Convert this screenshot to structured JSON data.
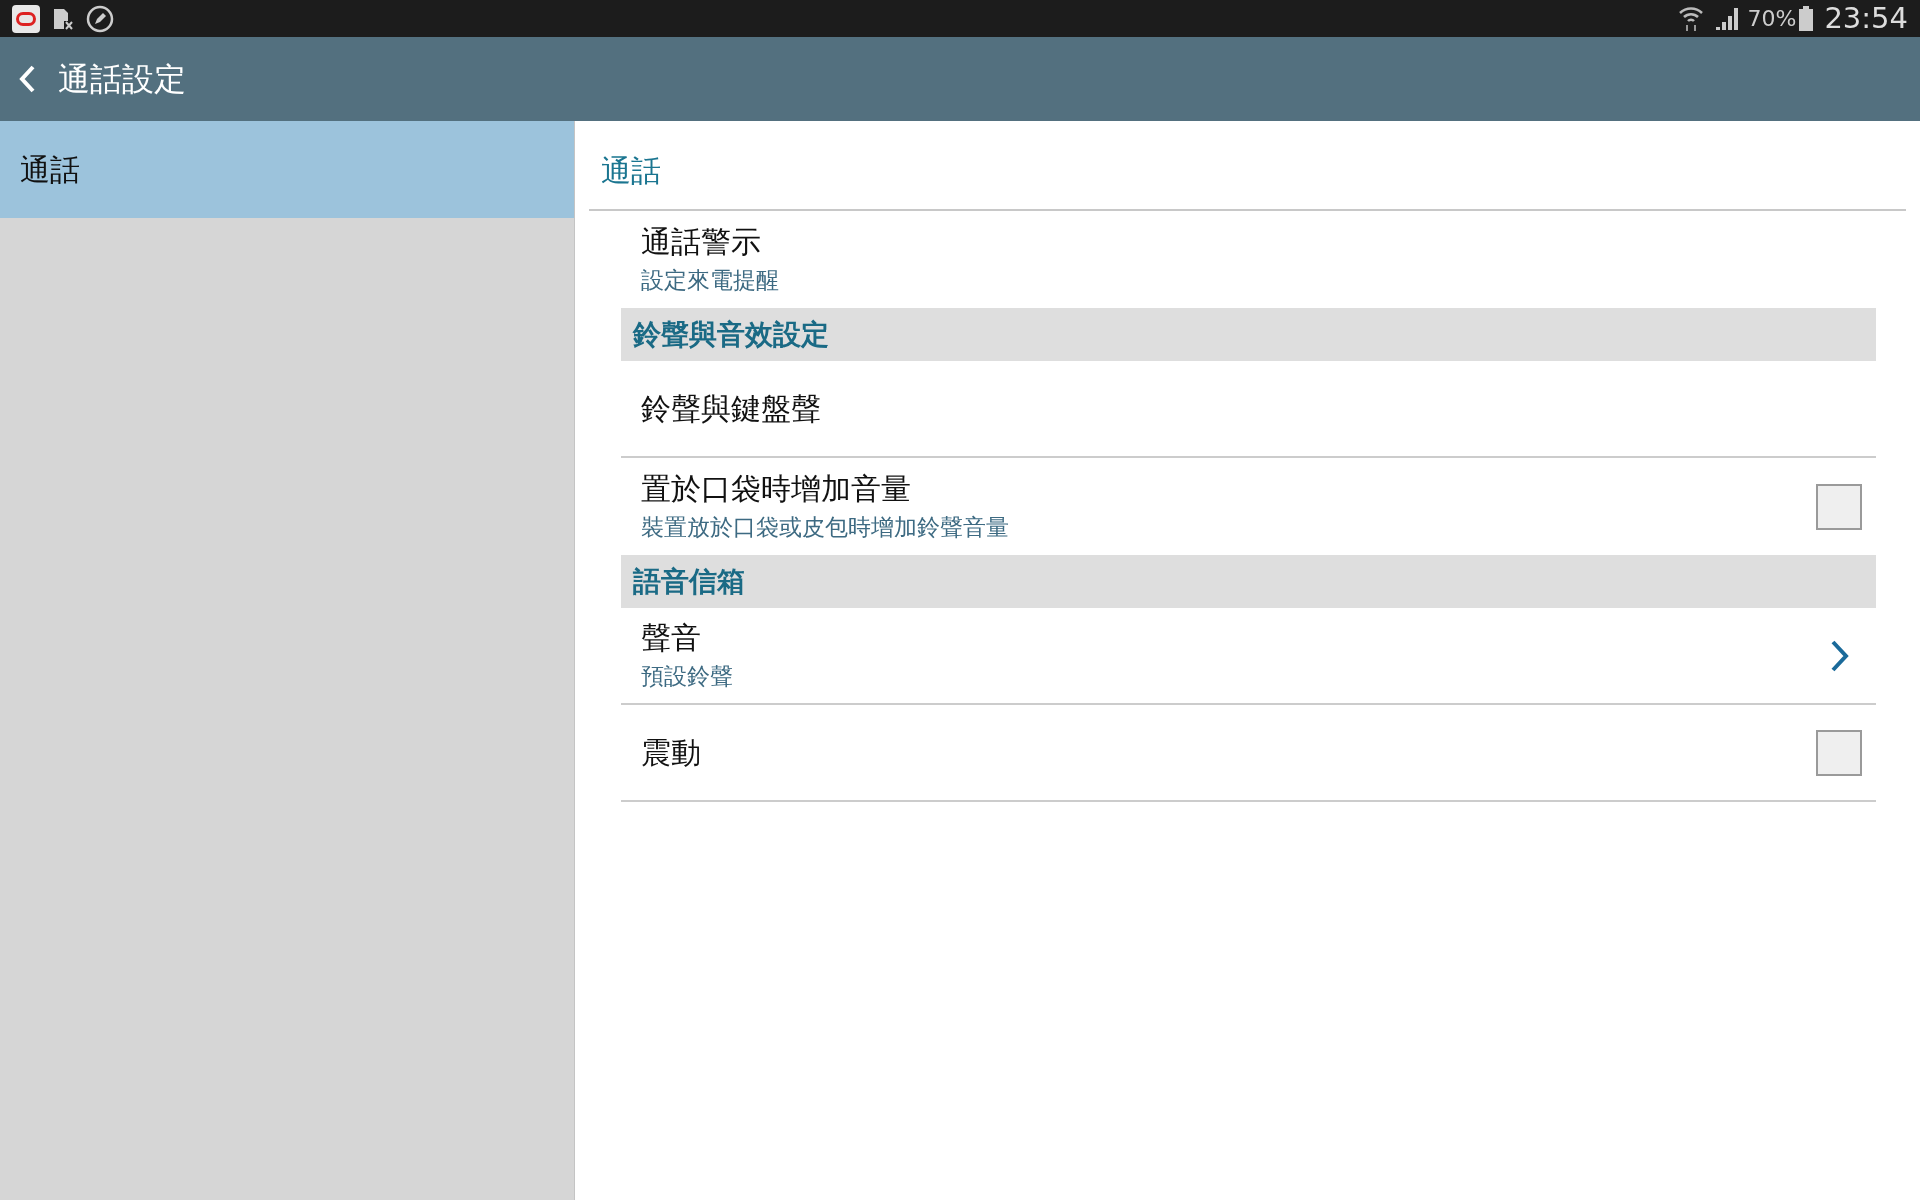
{
  "status_bar": {
    "battery": "70%",
    "time": "23:54"
  },
  "header": {
    "title": "通話設定"
  },
  "sidebar": {
    "items": [
      {
        "label": "通話",
        "selected": true
      }
    ]
  },
  "panel": {
    "title": "通話",
    "items": [
      {
        "kind": "plain",
        "title": "通話警示",
        "subtitle": "設定來電提醒"
      },
      {
        "kind": "section",
        "title": "鈴聲與音效設定"
      },
      {
        "kind": "plain",
        "title": "鈴聲與鍵盤聲"
      },
      {
        "kind": "checkbox",
        "title": "置於口袋時增加音量",
        "subtitle": "裝置放於口袋或皮包時增加鈴聲音量",
        "checked": false
      },
      {
        "kind": "section",
        "title": "語音信箱"
      },
      {
        "kind": "chevron",
        "title": "聲音",
        "subtitle": "預設鈴聲"
      },
      {
        "kind": "checkbox",
        "title": "震動",
        "checked": false
      }
    ]
  }
}
